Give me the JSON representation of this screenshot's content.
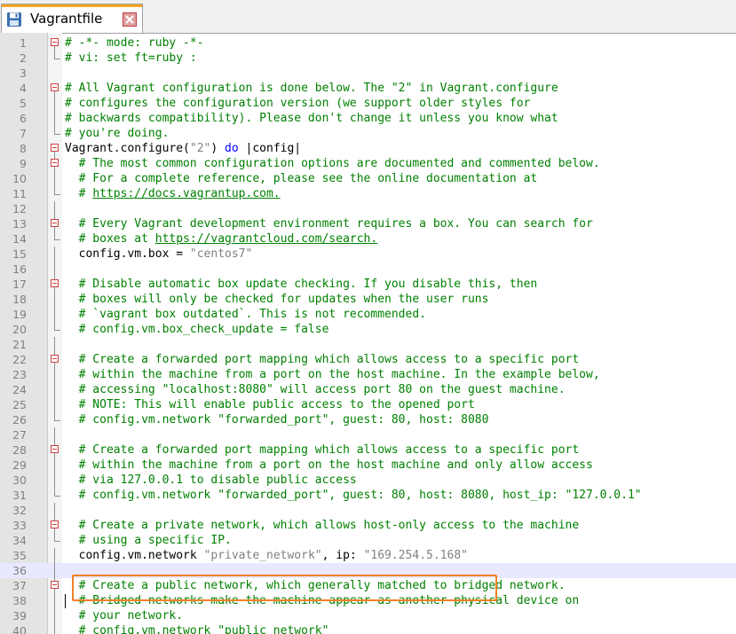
{
  "tab": {
    "title": "Vagrantfile"
  },
  "highlight_line": 35,
  "current_line": 36,
  "lines": [
    {
      "n": "1",
      "fold": "box",
      "segs": [
        [
          "c",
          "# -*- mode: ruby -*-"
        ]
      ]
    },
    {
      "n": "2",
      "fold": "end",
      "segs": [
        [
          "c",
          "# vi: set ft=ruby :"
        ]
      ]
    },
    {
      "n": "3",
      "fold": "",
      "segs": []
    },
    {
      "n": "4",
      "fold": "box",
      "segs": [
        [
          "c",
          "# All Vagrant configuration is done below. The \"2\" in Vagrant.configure"
        ]
      ]
    },
    {
      "n": "5",
      "fold": "line",
      "segs": [
        [
          "c",
          "# configures the configuration version (we support older styles for"
        ]
      ]
    },
    {
      "n": "6",
      "fold": "line",
      "segs": [
        [
          "c",
          "# backwards compatibility). Please don't change it unless you know what"
        ]
      ]
    },
    {
      "n": "7",
      "fold": "end",
      "segs": [
        [
          "c",
          "# you're doing."
        ]
      ]
    },
    {
      "n": "8",
      "fold": "box",
      "segs": [
        [
          "t",
          "Vagrant.configure("
        ],
        [
          "s",
          "\"2\""
        ],
        [
          "t",
          ") "
        ],
        [
          "k",
          "do"
        ],
        [
          "t",
          " |config|"
        ]
      ]
    },
    {
      "n": "9",
      "fold": "box",
      "segs": [
        [
          "t",
          "  "
        ],
        [
          "c",
          "# The most common configuration options are documented and commented below."
        ]
      ]
    },
    {
      "n": "10",
      "fold": "line",
      "segs": [
        [
          "t",
          "  "
        ],
        [
          "c",
          "# For a complete reference, please see the online documentation at"
        ]
      ]
    },
    {
      "n": "11",
      "fold": "end",
      "segs": [
        [
          "t",
          "  "
        ],
        [
          "c",
          "# "
        ],
        [
          "u",
          "https://docs.vagrantup.com."
        ]
      ]
    },
    {
      "n": "12",
      "fold": "line",
      "segs": []
    },
    {
      "n": "13",
      "fold": "box",
      "segs": [
        [
          "t",
          "  "
        ],
        [
          "c",
          "# Every Vagrant development environment requires a box. You can search for"
        ]
      ]
    },
    {
      "n": "14",
      "fold": "end",
      "segs": [
        [
          "t",
          "  "
        ],
        [
          "c",
          "# boxes at "
        ],
        [
          "u",
          "https://vagrantcloud.com/search."
        ]
      ]
    },
    {
      "n": "15",
      "fold": "line",
      "segs": [
        [
          "t",
          "  config.vm.box = "
        ],
        [
          "s",
          "\"centos7\""
        ]
      ]
    },
    {
      "n": "16",
      "fold": "line",
      "segs": []
    },
    {
      "n": "17",
      "fold": "box",
      "segs": [
        [
          "t",
          "  "
        ],
        [
          "c",
          "# Disable automatic box update checking. If you disable this, then"
        ]
      ]
    },
    {
      "n": "18",
      "fold": "line",
      "segs": [
        [
          "t",
          "  "
        ],
        [
          "c",
          "# boxes will only be checked for updates when the user runs"
        ]
      ]
    },
    {
      "n": "19",
      "fold": "line",
      "segs": [
        [
          "t",
          "  "
        ],
        [
          "c",
          "# `vagrant box outdated`. This is not recommended."
        ]
      ]
    },
    {
      "n": "20",
      "fold": "end",
      "segs": [
        [
          "t",
          "  "
        ],
        [
          "c",
          "# config.vm.box_check_update = false"
        ]
      ]
    },
    {
      "n": "21",
      "fold": "line",
      "segs": []
    },
    {
      "n": "22",
      "fold": "box",
      "segs": [
        [
          "t",
          "  "
        ],
        [
          "c",
          "# Create a forwarded port mapping which allows access to a specific port"
        ]
      ]
    },
    {
      "n": "23",
      "fold": "line",
      "segs": [
        [
          "t",
          "  "
        ],
        [
          "c",
          "# within the machine from a port on the host machine. In the example below,"
        ]
      ]
    },
    {
      "n": "24",
      "fold": "line",
      "segs": [
        [
          "t",
          "  "
        ],
        [
          "c",
          "# accessing \"localhost:8080\" will access port 80 on the guest machine."
        ]
      ]
    },
    {
      "n": "25",
      "fold": "line",
      "segs": [
        [
          "t",
          "  "
        ],
        [
          "c",
          "# NOTE: This will enable public access to the opened port"
        ]
      ]
    },
    {
      "n": "26",
      "fold": "end",
      "segs": [
        [
          "t",
          "  "
        ],
        [
          "c",
          "# config.vm.network \"forwarded_port\", guest: 80, host: 8080"
        ]
      ]
    },
    {
      "n": "27",
      "fold": "line",
      "segs": []
    },
    {
      "n": "28",
      "fold": "box",
      "segs": [
        [
          "t",
          "  "
        ],
        [
          "c",
          "# Create a forwarded port mapping which allows access to a specific port"
        ]
      ]
    },
    {
      "n": "29",
      "fold": "line",
      "segs": [
        [
          "t",
          "  "
        ],
        [
          "c",
          "# within the machine from a port on the host machine and only allow access"
        ]
      ]
    },
    {
      "n": "30",
      "fold": "line",
      "segs": [
        [
          "t",
          "  "
        ],
        [
          "c",
          "# via 127.0.0.1 to disable public access"
        ]
      ]
    },
    {
      "n": "31",
      "fold": "end",
      "segs": [
        [
          "t",
          "  "
        ],
        [
          "c",
          "# config.vm.network \"forwarded_port\", guest: 80, host: 8080, host_ip: \"127.0.0.1\""
        ]
      ]
    },
    {
      "n": "32",
      "fold": "line",
      "segs": []
    },
    {
      "n": "33",
      "fold": "box",
      "segs": [
        [
          "t",
          "  "
        ],
        [
          "c",
          "# Create a private network, which allows host-only access to the machine"
        ]
      ]
    },
    {
      "n": "34",
      "fold": "end",
      "segs": [
        [
          "t",
          "  "
        ],
        [
          "c",
          "# using a specific IP."
        ]
      ]
    },
    {
      "n": "35",
      "fold": "line",
      "segs": [
        [
          "t",
          "  config.vm.network "
        ],
        [
          "s",
          "\"private_network\""
        ],
        [
          "t",
          ", ip: "
        ],
        [
          "s",
          "\"169.254.5.168\""
        ]
      ]
    },
    {
      "n": "36",
      "fold": "line",
      "segs": []
    },
    {
      "n": "37",
      "fold": "box",
      "segs": [
        [
          "t",
          "  "
        ],
        [
          "c",
          "# Create a public network, which generally matched to bridged network."
        ]
      ]
    },
    {
      "n": "38",
      "fold": "line",
      "segs": [
        [
          "t",
          "  "
        ],
        [
          "c",
          "# Bridged networks make the machine appear as another physical device on"
        ]
      ]
    },
    {
      "n": "39",
      "fold": "line",
      "segs": [
        [
          "t",
          "  "
        ],
        [
          "c",
          "# your network."
        ]
      ]
    },
    {
      "n": "40",
      "fold": "line",
      "segs": [
        [
          "t",
          "  "
        ],
        [
          "c",
          "# config.vm.network \"public_network\""
        ]
      ]
    }
  ],
  "colors": {
    "comment": "#008000",
    "string": "#808080",
    "keyword": "#0000ff",
    "highlight_border": "#f08028",
    "fold_marker": "#d04040",
    "tab_accent": "#f5a623"
  }
}
